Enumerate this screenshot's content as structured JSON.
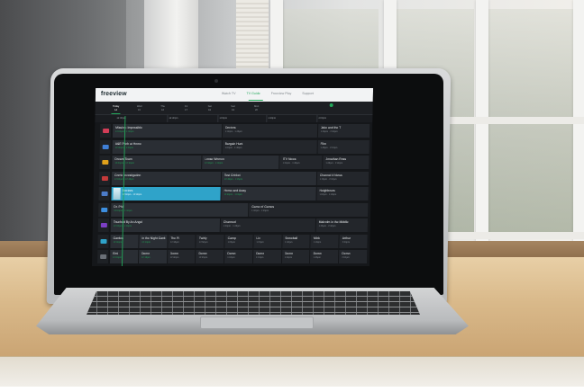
{
  "app": {
    "logo": "freeview"
  },
  "nav": {
    "items": [
      {
        "label": "Watch TV",
        "active": false
      },
      {
        "label": "TV Guide",
        "active": true
      },
      {
        "label": "Freeview Play",
        "active": false
      },
      {
        "label": "Support",
        "active": false
      }
    ]
  },
  "days": [
    {
      "name": "Today",
      "date": "14",
      "active": true
    },
    {
      "name": "Wed",
      "date": "15",
      "active": false
    },
    {
      "name": "Thu",
      "date": "16",
      "active": false
    },
    {
      "name": "Fri",
      "date": "17",
      "active": false
    },
    {
      "name": "Sat",
      "date": "18",
      "active": false
    },
    {
      "name": "Sun",
      "date": "19",
      "active": false
    },
    {
      "name": "Mon",
      "date": "20",
      "active": false
    }
  ],
  "tonight": {
    "label": "Tonight"
  },
  "times": [
    "12:00pm",
    "12:30pm",
    "1:00pm",
    "1:30pm",
    "2:00pm"
  ],
  "accent": "#22a85a",
  "selected_color": "#2fa3c9",
  "channels": [
    {
      "icon": "bbc-one-icon",
      "color": "#d23d57",
      "programmes": [
        {
          "title": "Mission: Impossible",
          "time": "12:00pm - 1:00pm",
          "state": "now"
        },
        {
          "title": "Doctors",
          "time": "1:00pm - 1:45pm",
          "state": "later"
        },
        {
          "title": "Jake and the T",
          "time": "1:45pm - 2:30pm",
          "state": "later"
        }
      ]
    },
    {
      "icon": "bbc-two-icon",
      "color": "#3f7fd6",
      "programmes": [
        {
          "title": "A&E Pitch at Home",
          "time": "12:00pm - 1:00pm",
          "state": "now"
        },
        {
          "title": "Bargain Hunt",
          "time": "1:00pm - 1:45pm",
          "state": "later"
        },
        {
          "title": "Film",
          "time": "1:45pm - 2:15pm",
          "state": "later"
        }
      ]
    },
    {
      "icon": "itv-icon",
      "color": "#e0a11b",
      "programmes": [
        {
          "title": "Dream Team",
          "time": "12:00pm - 12:30pm",
          "state": "now"
        },
        {
          "title": "Loose Women",
          "time": "12:30pm - 1:00pm",
          "state": "now"
        },
        {
          "title": "ITV News",
          "time": "1:00pm - 1:45pm",
          "state": "later"
        },
        {
          "title": "Jonathan Ross",
          "time": "1:45pm - 2:30pm",
          "state": "later"
        }
      ]
    },
    {
      "icon": "channel-4-icon",
      "color": "#c43a3a",
      "programmes": [
        {
          "title": "Corrie Investigation",
          "time": "12:00pm - 12:45pm",
          "state": "now"
        },
        {
          "title": "Test Cricket",
          "time": "12:45pm - 1:15pm",
          "state": "now"
        },
        {
          "title": "Channel 4 News",
          "time": "1:15pm - 2:00pm",
          "state": "later"
        }
      ]
    },
    {
      "icon": "channel-5-icon",
      "color": "#4c7cc9",
      "programmes": [
        {
          "title": "Doctors",
          "time": "12:00pm - 12:30pm",
          "state": "sel"
        },
        {
          "title": "Home and Away",
          "time": "12:30pm - 1:00pm",
          "state": "now"
        },
        {
          "title": "Neighbours",
          "time": "1:00pm - 1:45pm",
          "state": "later"
        }
      ]
    },
    {
      "icon": "sky-icon",
      "color": "#3d8fe0",
      "programmes": [
        {
          "title": "Dr. Phil",
          "time": "12:00pm - 1:00pm",
          "state": "now"
        },
        {
          "title": "Game of Games",
          "time": "1:00pm - 1:45pm",
          "state": "later"
        }
      ]
    },
    {
      "icon": "film4-icon",
      "color": "#7c3fc4",
      "programmes": [
        {
          "title": "Touched By An Angel",
          "time": "12:00pm - 1:00pm",
          "state": "now"
        },
        {
          "title": "Charmed",
          "time": "1:00pm - 1:45pm",
          "state": "later"
        },
        {
          "title": "Malcolm in the Middle",
          "time": "1:45pm - 2:30pm",
          "state": "later"
        }
      ]
    },
    {
      "icon": "ten-icon",
      "color": "#2fa3c9",
      "programmes": [
        {
          "title": "Garden",
          "time": "12:00pm",
          "state": "now"
        },
        {
          "title": "In the Night Garden",
          "time": "12:10pm",
          "state": "now"
        },
        {
          "title": "The Pi",
          "time": "12:35pm",
          "state": "later"
        },
        {
          "title": "Twirly",
          "time": "12:50pm",
          "state": "later"
        },
        {
          "title": "Camp",
          "time": "1:05pm",
          "state": "later"
        },
        {
          "title": "Liv",
          "time": "1:20pm",
          "state": "later"
        },
        {
          "title": "Snowball",
          "time": "1:30pm",
          "state": "later"
        },
        {
          "title": "Mick",
          "time": "1:45pm",
          "state": "later"
        },
        {
          "title": "Arthur",
          "time": "2:00pm",
          "state": "later"
        }
      ]
    },
    {
      "icon": "kids-icon",
      "color": "#6b7077",
      "programmes": [
        {
          "title": "Emi",
          "time": "12:00pm",
          "state": "now"
        },
        {
          "title": "Demo",
          "time": "12:15pm",
          "state": "now"
        },
        {
          "title": "Demo",
          "time": "12:30pm",
          "state": "later"
        },
        {
          "title": "Demo",
          "time": "12:45pm",
          "state": "later"
        },
        {
          "title": "Demo",
          "time": "1:00pm",
          "state": "later"
        },
        {
          "title": "Demo",
          "time": "1:15pm",
          "state": "later"
        },
        {
          "title": "Demo",
          "time": "1:30pm",
          "state": "later"
        },
        {
          "title": "Demo",
          "time": "1:45pm",
          "state": "later"
        },
        {
          "title": "Demo",
          "time": "2:00pm",
          "state": "later"
        }
      ]
    }
  ]
}
